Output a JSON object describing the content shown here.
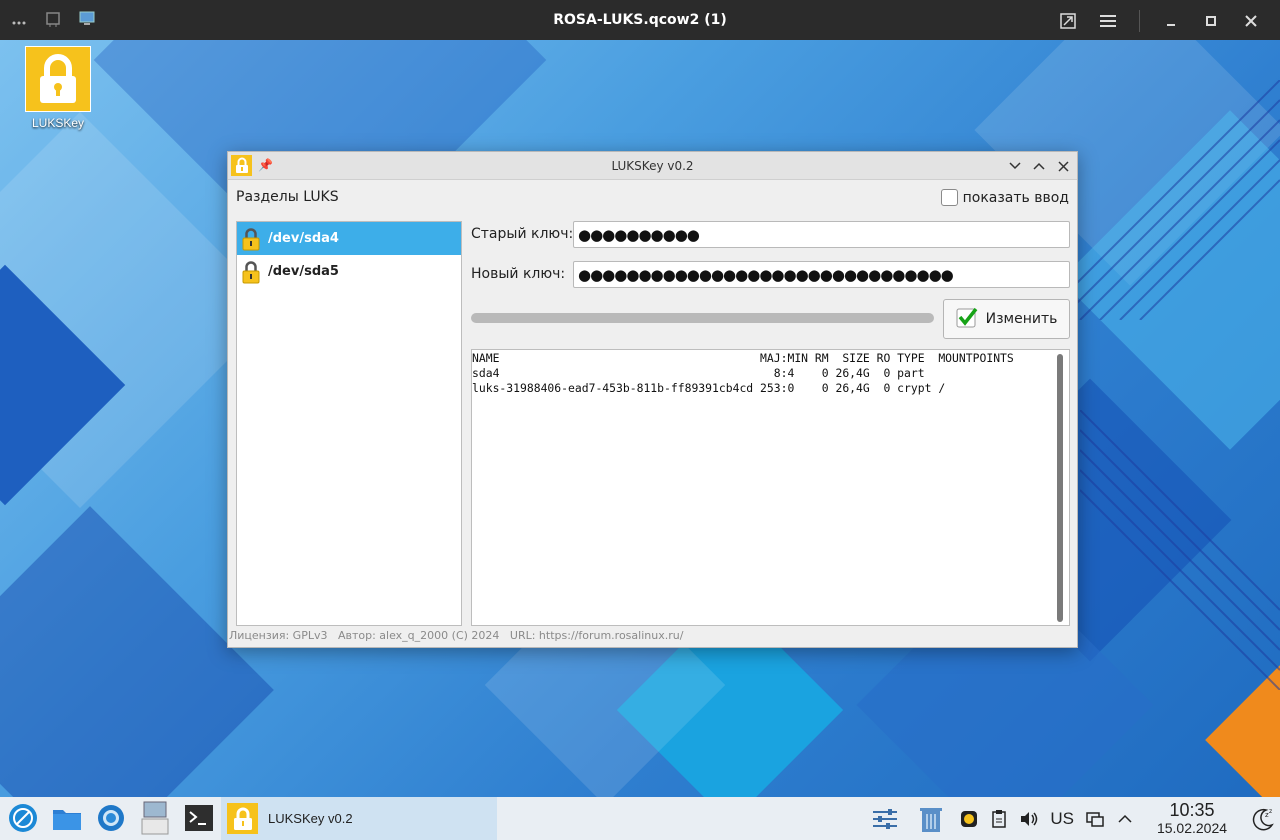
{
  "host": {
    "title": "ROSA-LUKS.qcow2 (1)"
  },
  "desktop": {
    "icon_label": "LUKSKey"
  },
  "window": {
    "title": "LUKSKey v0.2",
    "section_label": "Разделы LUKS",
    "show_input_label": "показать ввод",
    "show_input_checked": false,
    "partitions": [
      {
        "name": "/dev/sda4",
        "selected": true
      },
      {
        "name": "/dev/sda5",
        "selected": false
      }
    ],
    "old_key_label": "Старый ключ:",
    "old_key_value": "●●●●●●●●●●",
    "new_key_label": "Новый ключ:",
    "new_key_value": "●●●●●●●●●●●●●●●●●●●●●●●●●●●●●●●",
    "progress": 1.0,
    "change_button": "Изменить",
    "output": "NAME                                      MAJ:MIN RM  SIZE RO TYPE  MOUNTPOINTS\nsda4                                        8:4    0 26,4G  0 part\nluks-31988406-ead7-453b-811b-ff89391cb4cd 253:0    0 26,4G  0 crypt /",
    "footer": "Лицензия: GPLv3   Автор: alex_q_2000 (C) 2024   URL: https://forum.rosalinux.ru/"
  },
  "taskbar": {
    "task_label": "LUKSKey v0.2",
    "keyboard_layout": "US",
    "time": "10:35",
    "date": "15.02.2024"
  },
  "colors": {
    "accent": "#3daee9",
    "lock_yellow": "#f6c21c",
    "taskbar_bg": "#e9eef3"
  }
}
